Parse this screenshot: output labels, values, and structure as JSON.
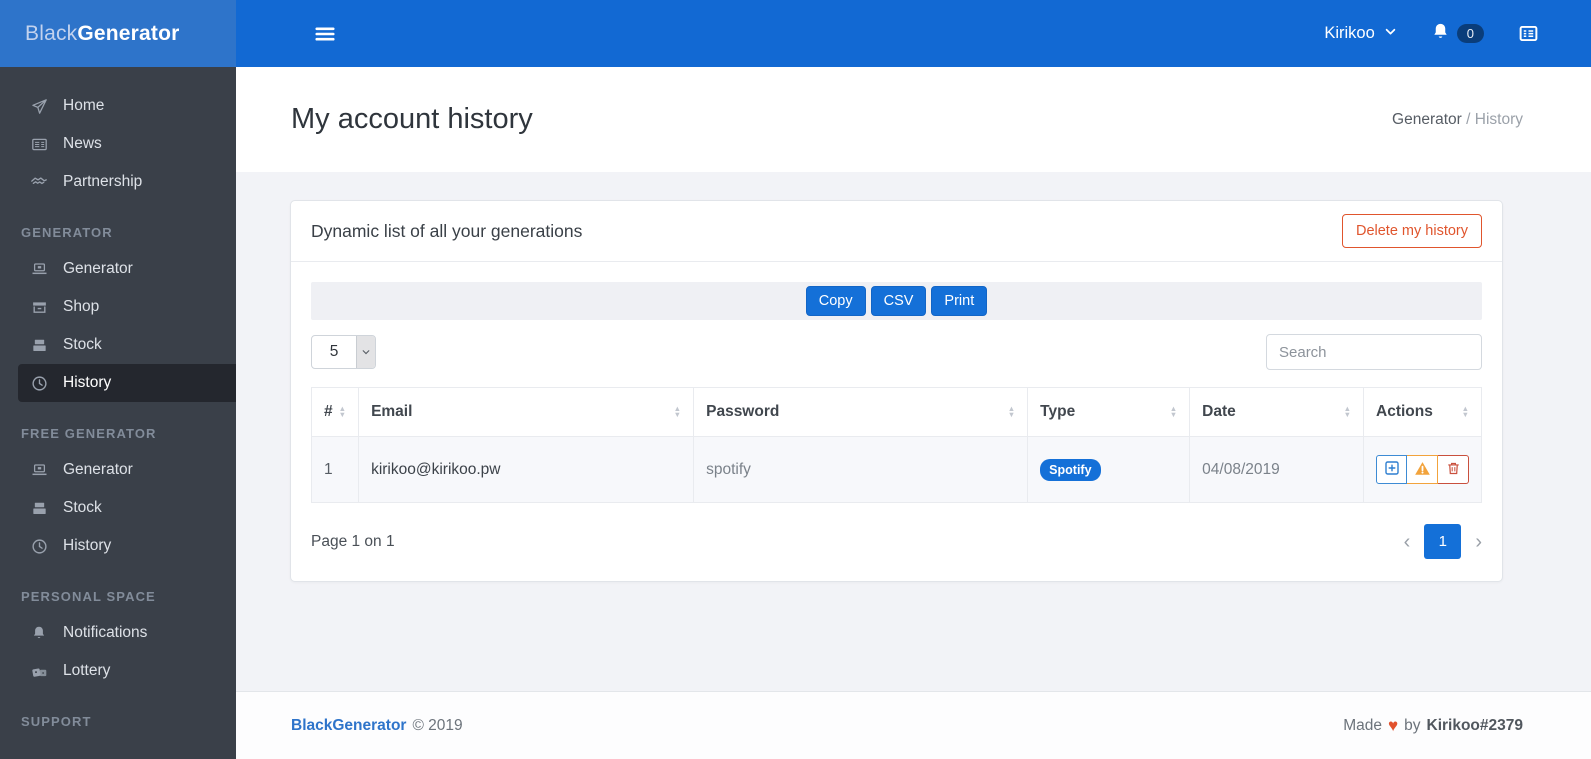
{
  "brand": {
    "part1": "Black",
    "part2": "Generator"
  },
  "navbar": {
    "user_label": "Kirikoo",
    "notification_count": "0"
  },
  "sidebar": {
    "sections": [
      {
        "header": "",
        "items": [
          {
            "label": "Home",
            "icon": "paper-plane-icon"
          },
          {
            "label": "News",
            "icon": "newspaper-icon"
          },
          {
            "label": "Partnership",
            "icon": "handshake-icon"
          }
        ]
      },
      {
        "header": "GENERATOR",
        "items": [
          {
            "label": "Generator",
            "icon": "laptop-icon"
          },
          {
            "label": "Shop",
            "icon": "shop-icon"
          },
          {
            "label": "Stock",
            "icon": "boxes-icon"
          },
          {
            "label": "History",
            "icon": "clock-icon",
            "active": true
          }
        ]
      },
      {
        "header": "FREE GENERATOR",
        "items": [
          {
            "label": "Generator",
            "icon": "laptop-icon"
          },
          {
            "label": "Stock",
            "icon": "boxes-icon"
          },
          {
            "label": "History",
            "icon": "clock-icon"
          }
        ]
      },
      {
        "header": "PERSONAL SPACE",
        "items": [
          {
            "label": "Notifications",
            "icon": "bell-icon"
          },
          {
            "label": "Lottery",
            "icon": "dice-icon"
          }
        ]
      },
      {
        "header": "SUPPORT",
        "items": []
      }
    ]
  },
  "page": {
    "title": "My account history",
    "breadcrumb_parent": "Generator",
    "breadcrumb_separator": "/",
    "breadcrumb_current": "History"
  },
  "card": {
    "title": "Dynamic list of all your generations",
    "delete_button_label": "Delete my history",
    "export_buttons": [
      "Copy",
      "CSV",
      "Print"
    ],
    "page_length_value": "5",
    "search_placeholder": "Search",
    "table": {
      "headers": [
        "#",
        "Email",
        "Password",
        "Type",
        "Date",
        "Actions"
      ],
      "rows": [
        {
          "num": "1",
          "email": "kirikoo@kirikoo.pw",
          "password": "spotify",
          "type_badge": "Spotify",
          "date": "04/08/2019"
        }
      ]
    },
    "pagination": {
      "info": "Page 1 on 1",
      "current_page": "1"
    }
  },
  "footer": {
    "brand": "BlackGenerator",
    "copyright": "© 2019",
    "made_prefix": "Made",
    "made_middle": "by",
    "author": "Kirikoo#2379",
    "heart_glyph": "♥"
  },
  "colors": {
    "navbar_blue": "#1269d3",
    "brand_blue": "#2e74ca",
    "sidebar_dark": "#3a4049",
    "sidebar_active": "#24272e",
    "primary_button_blue": "#1470d8",
    "delete_orange": "#e0552d",
    "warning_orange": "#f2a33c",
    "danger_red": "#c9503d",
    "content_gray": "#f2f3f7"
  }
}
